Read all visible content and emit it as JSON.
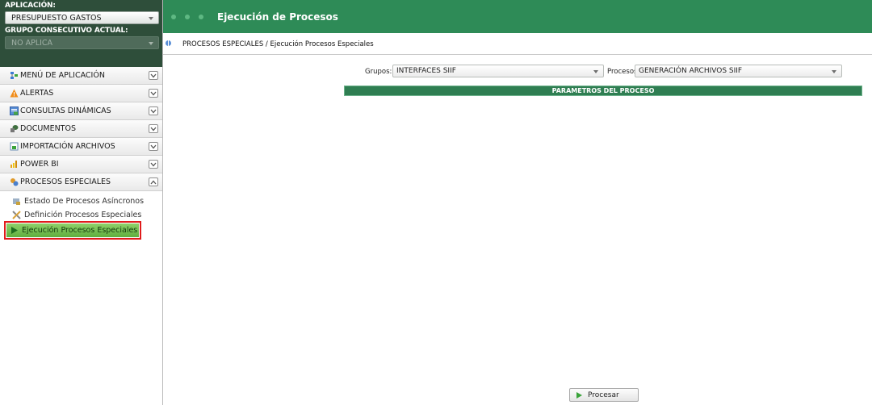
{
  "sidebar": {
    "app_label": "APLICACIÓN:",
    "app_value": "PRESUPUESTO GASTOS",
    "group_label": "GRUPO CONSECUTIVO ACTUAL:",
    "group_value": "NO APLICA",
    "menu": [
      {
        "label": "MENÚ DE APLICACIÓN",
        "icon": "app-menu-icon",
        "state": "collapsed"
      },
      {
        "label": "ALERTAS",
        "icon": "alert-triangle-icon",
        "state": "collapsed"
      },
      {
        "label": "CONSULTAS DINÁMICAS",
        "icon": "query-icon",
        "state": "collapsed"
      },
      {
        "label": "DOCUMENTOS",
        "icon": "documents-icon",
        "state": "collapsed"
      },
      {
        "label": "IMPORTACIÓN ARCHIVOS",
        "icon": "import-icon",
        "state": "collapsed"
      },
      {
        "label": "POWER BI",
        "icon": "power-bi-icon",
        "state": "collapsed"
      },
      {
        "label": "PROCESOS ESPECIALES",
        "icon": "special-processes-icon",
        "state": "expanded"
      }
    ],
    "submenu": [
      {
        "label": "Estado De Procesos Asíncronos",
        "icon": "async-status-icon"
      },
      {
        "label": "Definición Procesos Especiales",
        "icon": "tools-icon"
      },
      {
        "label": "Ejecución Procesos Especiales",
        "icon": "play-icon",
        "selected": true
      }
    ]
  },
  "header": {
    "title": "Ejecución de Procesos"
  },
  "breadcrumb": "PROCESOS ESPECIALES / Ejecución Procesos Especiales",
  "form": {
    "groups_label": "Grupos:",
    "groups_value": "INTERFACES SIIF",
    "processes_label": "Procesos:",
    "processes_value": "GENERACIÓN ARCHIVOS SIIF",
    "params_header": "PARAMETROS DEL PROCESO",
    "process_button": "Procesar"
  },
  "colors": {
    "topbar": "#2e8b57",
    "sidebar_header": "#2e4e3a",
    "selected_item": "#6cbd48",
    "highlight_border": "#e01b1b"
  }
}
